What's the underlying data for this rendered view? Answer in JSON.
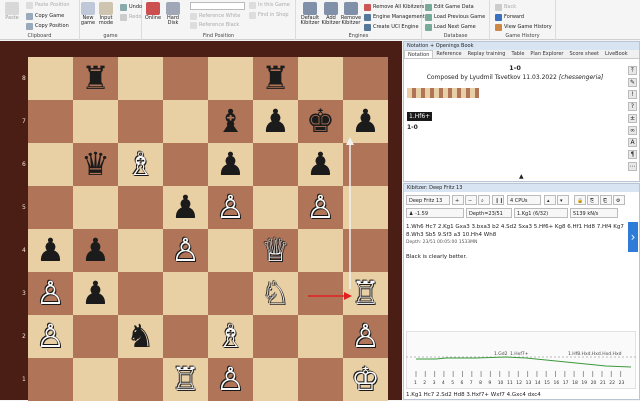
{
  "ribbon": {
    "clipboard": {
      "label": "Clipboard",
      "paste": "Paste",
      "paste_position": "Paste Position",
      "copy_game": "Copy Game",
      "copy_position": "Copy Position"
    },
    "game": {
      "label": "game",
      "new_game": "New game",
      "input_mode": "Input mode",
      "undo": "Undo",
      "redo": "Redo"
    },
    "find": {
      "label": "Find Position",
      "online": "Online",
      "hard_disk": "Hard Disk",
      "search_text": "In this Game",
      "find_shop": "Find in Shop",
      "ref_white": "Reference White",
      "ref_black": "Reference Black"
    },
    "engines": {
      "label": "Engines",
      "default_kibitzer": "Default Kibitzer",
      "add_kibitzer": "Add Kibitzer",
      "remove_kibitzer": "Remove Kibitzer",
      "remove_all": "Remove All Kibitzers",
      "engine_mgmt": "Engine Management",
      "create_uci": "Create UCI Engine"
    },
    "database": {
      "label": "Database",
      "edit_game_data": "Edit Game Data",
      "load_previous": "Load Previous Game",
      "load_next": "Load Next Game"
    },
    "history": {
      "label": "Game History",
      "back": "Back",
      "forward": "Forward",
      "view_history": "View Game History"
    }
  },
  "board": {
    "ranks": [
      "8",
      "7",
      "6",
      "5",
      "4",
      "3",
      "2",
      "1"
    ],
    "pieces": [
      {
        "glyph": "♜",
        "side": "b",
        "file": 1,
        "rank": 8
      },
      {
        "glyph": "♜",
        "side": "b",
        "file": 5,
        "rank": 8
      },
      {
        "glyph": "♝",
        "side": "b",
        "file": 4,
        "rank": 7
      },
      {
        "glyph": "♟",
        "side": "b",
        "file": 5,
        "rank": 7
      },
      {
        "glyph": "♚",
        "side": "b",
        "file": 6,
        "rank": 7
      },
      {
        "glyph": "♟",
        "side": "b",
        "file": 7,
        "rank": 7
      },
      {
        "glyph": "♛",
        "side": "b",
        "file": 1,
        "rank": 6
      },
      {
        "glyph": "♗",
        "side": "w",
        "file": 2,
        "rank": 6
      },
      {
        "glyph": "♟",
        "side": "b",
        "file": 4,
        "rank": 6
      },
      {
        "glyph": "♟",
        "side": "b",
        "file": 6,
        "rank": 6
      },
      {
        "glyph": "♟",
        "side": "b",
        "file": 3,
        "rank": 5
      },
      {
        "glyph": "♙",
        "side": "w",
        "file": 4,
        "rank": 5
      },
      {
        "glyph": "♙",
        "side": "w",
        "file": 6,
        "rank": 5
      },
      {
        "glyph": "♟",
        "side": "b",
        "file": 0,
        "rank": 4
      },
      {
        "glyph": "♟",
        "side": "b",
        "file": 1,
        "rank": 4
      },
      {
        "glyph": "♙",
        "side": "w",
        "file": 3,
        "rank": 4
      },
      {
        "glyph": "♕",
        "side": "w",
        "file": 5,
        "rank": 4
      },
      {
        "glyph": "♙",
        "side": "w",
        "file": 0,
        "rank": 3
      },
      {
        "glyph": "♟",
        "side": "b",
        "file": 1,
        "rank": 3
      },
      {
        "glyph": "♘",
        "side": "w",
        "file": 5,
        "rank": 3
      },
      {
        "glyph": "♖",
        "side": "w",
        "file": 7,
        "rank": 3
      },
      {
        "glyph": "♙",
        "side": "w",
        "file": 0,
        "rank": 2
      },
      {
        "glyph": "♞",
        "side": "b",
        "file": 2,
        "rank": 2
      },
      {
        "glyph": "♗",
        "side": "w",
        "file": 4,
        "rank": 2
      },
      {
        "glyph": "♙",
        "side": "w",
        "file": 7,
        "rank": 2
      },
      {
        "glyph": "♖",
        "side": "w",
        "file": 3,
        "rank": 1
      },
      {
        "glyph": "♙",
        "side": "w",
        "file": 4,
        "rank": 1
      },
      {
        "glyph": "♔",
        "side": "w",
        "file": 7,
        "rank": 1
      }
    ],
    "arrow_colors": {
      "red": "#e02020",
      "white": "#f0f0f0"
    }
  },
  "notation": {
    "title": "Notation + Openings Book",
    "tabs": [
      "Notation",
      "Reference",
      "Replay training",
      "Table",
      "Plan Explorer",
      "Score sheet",
      "LiveBook"
    ],
    "result": "1-0",
    "composer": "Composed by Lyudmil Tsvetkov 11.03.2022",
    "source": "[chessengeria]",
    "move": "1.Hf6+",
    "final_result": "1-0"
  },
  "kibitzer": {
    "title": "Kibitzer: Deep Fritz 13",
    "engine": "Deep Fritz 13",
    "cpus": "4 CPUs",
    "eval": "-1.59",
    "depth": "Depth=23/51",
    "move_info": "1.Kg1 (6/32)",
    "speed": "5139 kN/s",
    "line": "1.Wh6 Hc7 2.Kg1 Gxa3 3.bxa3 b2 4.Sd2 Sxa3 5.Hf6+ Kg8 6.Hf1 Hd8 7.Hf4 Kg7 8.Wh3 Sb5 9.Sf3 a3 10.Hh4 Wh8",
    "depth_detail": "Depth: 23/51 00:05:00 1533MN",
    "comment": "Black is clearly better.",
    "graph_labels": [
      "1.Gd2",
      "1.Hxf7+",
      "1.Hf8.Hxd.Hxd.Hxd.Hxd"
    ],
    "graph_ticks": [
      "1",
      "2",
      "3",
      "4",
      "5",
      "6",
      "7",
      "8",
      "9",
      "10",
      "11",
      "12",
      "13",
      "14",
      "15",
      "16",
      "17",
      "18",
      "19",
      "20",
      "21",
      "22",
      "23"
    ],
    "bottom_line": "1.Kg1  Hc7  2.Sd2  Hd8  3.Hxf7+  Wxf7  4.Gxc4  dxc4"
  }
}
